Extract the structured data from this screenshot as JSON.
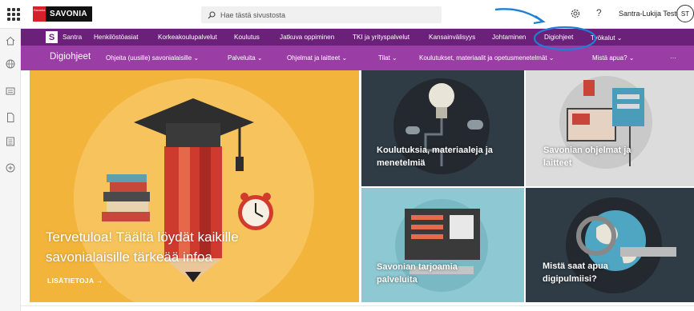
{
  "app": {
    "logo_text": "SAVONIA",
    "logo_small_text": "Savonia",
    "search_placeholder": "Hae tästä sivustosta",
    "user_name": "Santra-Lukija Testi",
    "user_initials": "ST",
    "help_symbol": "?"
  },
  "hub_nav": {
    "logo_letter": "S",
    "items": [
      "Santra",
      "Henkilöstöasiat",
      "Korkeakoulupalvelut",
      "Koulutus",
      "Jatkuva oppiminen",
      "TKI ja yrityspalvelut",
      "Kansainvälisyys",
      "Johtaminen",
      "Digiohjeet",
      "Työkalut ⌄"
    ]
  },
  "site_nav": {
    "title": "Digiohjeet",
    "items": [
      "Ohjeita (uusille) savonialaisille ⌄",
      "Palveluita ⌄",
      "Ohjelmat ja laitteet ⌄",
      "Tilat ⌄",
      "Koulutukset, materiaalit ja opetusmenetelmät ⌄",
      "Mistä apua? ⌄",
      "···"
    ]
  },
  "hero": {
    "main_title": "Tervetuloa! Täältä löydät kaikille savonialaisille tärkeää infoa",
    "main_link": "LISÄTIETOJA →",
    "tiles": [
      "Koulutuksia, materiaaleja ja menetelmiä",
      "Savonian ohjelmat ja laitteet",
      "Savonian tarjoamia palveluita",
      "Mistä saat apua digipulmiisi?"
    ]
  },
  "colors": {
    "hub_bar": "#6b2079",
    "site_bar": "#9a3ea6",
    "hero_yellow": "#f2b43b",
    "annotation_blue": "#1e7fd6"
  }
}
